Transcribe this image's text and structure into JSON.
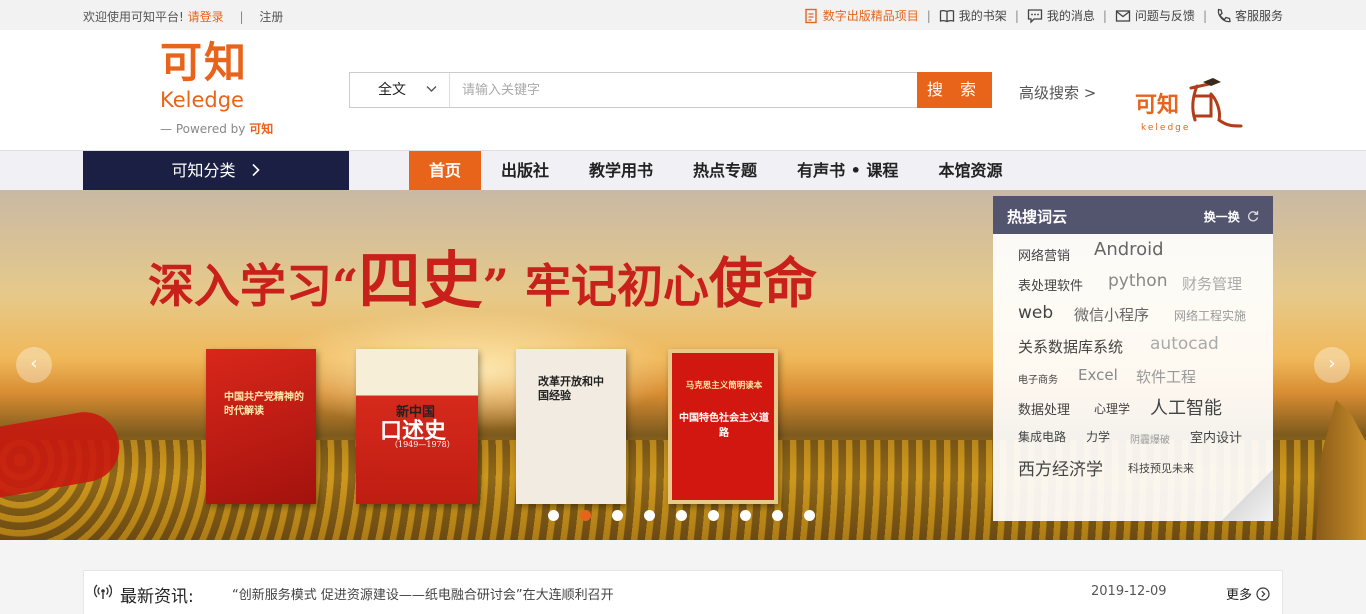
{
  "topbar": {
    "welcome": "欢迎使用可知平台!",
    "login": "请登录",
    "sep": "|",
    "register": "注册",
    "links": [
      {
        "label": "数字出版精品项目"
      },
      {
        "label": "我的书架"
      },
      {
        "label": "我的消息"
      },
      {
        "label": "问题与反馈"
      },
      {
        "label": "客服服务"
      }
    ]
  },
  "logo": {
    "cn": "可知",
    "en": "Keledge",
    "powered_by": "Powered by",
    "brand": "可知"
  },
  "search": {
    "scope": "全文",
    "placeholder": "请输入关键字",
    "button": "搜 索",
    "advanced": "高级搜索 >"
  },
  "partner_logo": {
    "cn": "可知",
    "en": "keledge"
  },
  "nav": {
    "category": "可知分类",
    "tabs": [
      {
        "label": "首页"
      },
      {
        "label": "出版社"
      },
      {
        "label": "教学用书"
      },
      {
        "label": "热点专题"
      },
      {
        "label": "有声书 • 课程"
      },
      {
        "label": "本馆资源"
      }
    ],
    "active_tab": "首页"
  },
  "banner": {
    "slogan_a": "深入学习“",
    "slogan_b": "四史",
    "slogan_c": "” 牢记初心",
    "slogan_d": "使命",
    "books": [
      {
        "title": "中国共产党精神的时代解读"
      },
      {
        "title_a": "新中国",
        "title_b": "口述史",
        "sub": "（1949—1978）"
      },
      {
        "title": "改革开放和中国经验"
      },
      {
        "series": "马克思主义简明读本",
        "title": "中国特色社会主义道路"
      }
    ],
    "slide_count": 9,
    "active_slide": 2
  },
  "hot_words": {
    "title": "热搜词云",
    "refresh": "换一换",
    "words": [
      {
        "text": "网络营销"
      },
      {
        "text": "Android"
      },
      {
        "text": "表处理软件"
      },
      {
        "text": "python"
      },
      {
        "text": "财务管理"
      },
      {
        "text": "web"
      },
      {
        "text": "微信小程序"
      },
      {
        "text": "网络工程实施"
      },
      {
        "text": "关系数据库系统"
      },
      {
        "text": "autocad"
      },
      {
        "text": "电子商务"
      },
      {
        "text": "Excel"
      },
      {
        "text": "软件工程"
      },
      {
        "text": "数据处理"
      },
      {
        "text": "心理学"
      },
      {
        "text": "人工智能"
      },
      {
        "text": "集成电路"
      },
      {
        "text": "力学"
      },
      {
        "text": "阴霾爆破"
      },
      {
        "text": "室内设计"
      },
      {
        "text": "西方经济学"
      },
      {
        "text": "科技预见未来"
      }
    ]
  },
  "news": {
    "label": "最新资讯:",
    "headline": "“创新服务模式 促进资源建设——纸电融合研讨会”在大连顺利召开",
    "date": "2019-12-09",
    "more": "更多"
  },
  "colors": {
    "accent": "#e8641b",
    "nav_dark": "#1b1f43",
    "hot_header": "#53546e",
    "slogan_red": "#c8201a"
  }
}
